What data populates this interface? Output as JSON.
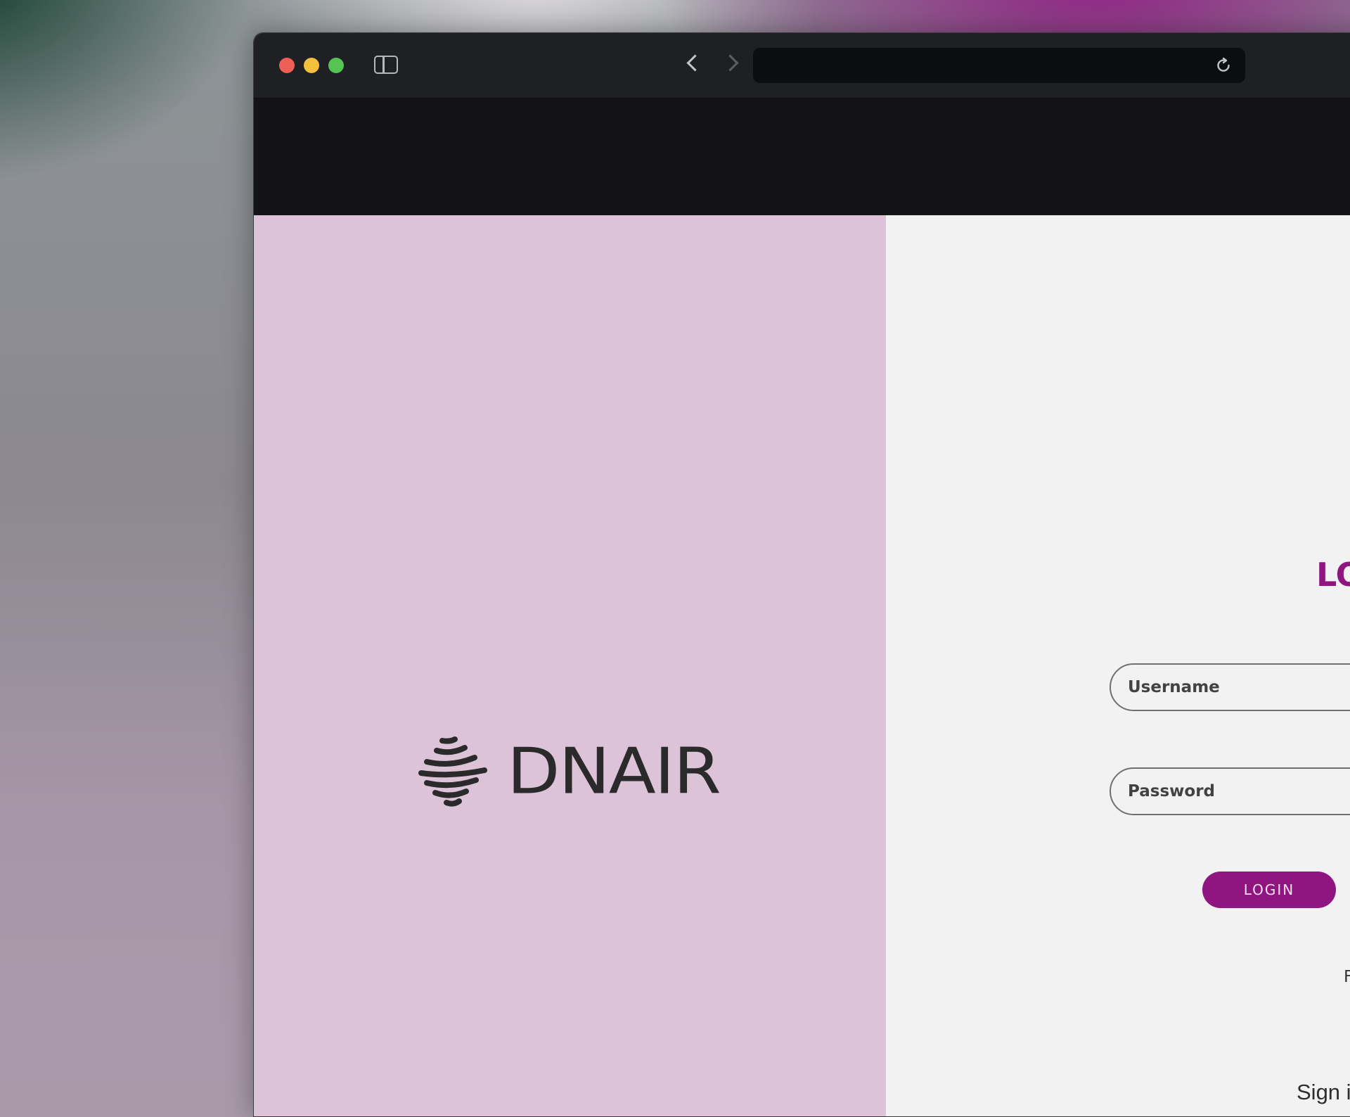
{
  "browser": {
    "url": "",
    "icons": [
      "sidebar-icon",
      "back-arrow-icon",
      "forward-arrow-icon",
      "shield-icon",
      "reload-icon"
    ]
  },
  "brand": {
    "logo_text": "DNAIR",
    "color": "#8f1580",
    "panel_color": "#dcc3d8"
  },
  "login": {
    "title": "LO",
    "username_placeholder": "Username",
    "password_placeholder": "Password",
    "button_label": "LOGIN",
    "forgot_text": "Forgot",
    "sign_in_with": "Sign in with:",
    "providers": [
      "google-icon"
    ]
  }
}
